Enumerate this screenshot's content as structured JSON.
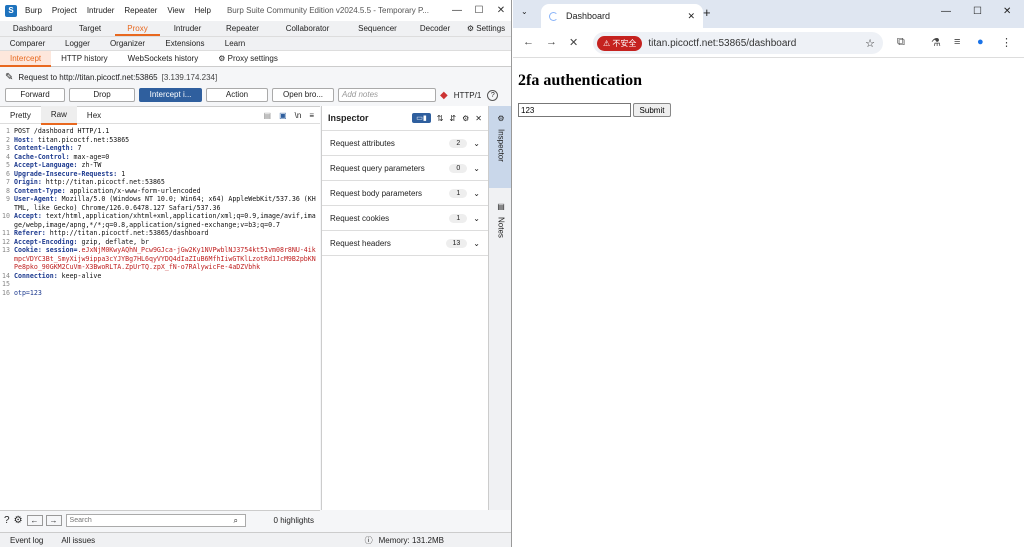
{
  "burp": {
    "title": "Burp Suite Community Edition v2024.5.5 - Temporary P...",
    "menu": [
      "Burp",
      "Project",
      "Intruder",
      "Repeater",
      "View",
      "Help"
    ],
    "tabs_row1": [
      "Dashboard",
      "Target",
      "Proxy",
      "Intruder",
      "Repeater",
      "Collaborator",
      "Sequencer",
      "Decoder",
      "Settings"
    ],
    "tabs_row2": [
      "Comparer",
      "Logger",
      "Organizer",
      "Extensions",
      "Learn"
    ],
    "sub_tabs": [
      "Intercept",
      "HTTP history",
      "WebSockets history",
      "Proxy settings"
    ],
    "request_to": "Request to http://titan.picoctf.net:53865",
    "request_ip": "[3.139.174.234]",
    "buttons": {
      "forward": "Forward",
      "drop": "Drop",
      "intercept": "Intercept i...",
      "action": "Action",
      "open_browser": "Open bro...",
      "notes_placeholder": "Add notes",
      "http_version": "HTTP/1"
    },
    "editor_tabs": [
      "Pretty",
      "Raw",
      "Hex"
    ],
    "code_lines": [
      {
        "n": "1",
        "k": "",
        "v": "POST /dashboard HTTP/1.1"
      },
      {
        "n": "2",
        "k": "Host:",
        "v": " titan.picoctf.net:53865"
      },
      {
        "n": "3",
        "k": "Content-Length:",
        "v": " 7"
      },
      {
        "n": "4",
        "k": "Cache-Control:",
        "v": " max-age=0"
      },
      {
        "n": "5",
        "k": "Accept-Language:",
        "v": " zh-TW"
      },
      {
        "n": "6",
        "k": "Upgrade-Insecure-Requests:",
        "v": " 1"
      },
      {
        "n": "7",
        "k": "Origin:",
        "v": " http://titan.picoctf.net:53865"
      },
      {
        "n": "8",
        "k": "Content-Type:",
        "v": " application/x-www-form-urlencoded"
      },
      {
        "n": "9",
        "k": "User-Agent:",
        "v": " Mozilla/5.0 (Windows NT 10.0; Win64; x64) AppleWebKit/537.36 (KHTML, like Gecko) Chrome/126.0.6478.127 Safari/537.36"
      },
      {
        "n": "10",
        "k": "Accept:",
        "v": " text/html,application/xhtml+xml,application/xml;q=0.9,image/avif,image/webp,image/apng,*/*;q=0.8,application/signed-exchange;v=b3;q=0.7"
      },
      {
        "n": "11",
        "k": "Referer:",
        "v": " http://titan.picoctf.net:53865/dashboard"
      },
      {
        "n": "12",
        "k": "Accept-Encoding:",
        "v": " gzip, deflate, br"
      },
      {
        "n": "13",
        "k": "Cookie:",
        "v": " session=",
        "cookie": ".eJxNjM0KwyAQhN_Pcw9GJca-jGw2Ky1NVPwblNJ3754kt51vm08r8NU-4ikmpcVDYC3Bt_SmyXijw9ippa3cYJYBg7HL6qyVYDQ4dIaZIuB6MfhIiwGTKlLzotRd1JcM9B2pbKNPe8pko_90GKM2CuVm-X3BwoRLTA.ZpUrTQ.zpX_fN-o7RAlywicFe-4aDZVbhk"
      },
      {
        "n": "14",
        "k": "Connection:",
        "v": " keep-alive"
      },
      {
        "n": "15",
        "k": "",
        "v": ""
      },
      {
        "n": "16",
        "k": "",
        "v": "otp=123"
      }
    ],
    "inspector": {
      "title": "Inspector",
      "rows": [
        {
          "label": "Request attributes",
          "count": "2"
        },
        {
          "label": "Request query parameters",
          "count": "0"
        },
        {
          "label": "Request body parameters",
          "count": "1"
        },
        {
          "label": "Request cookies",
          "count": "1"
        },
        {
          "label": "Request headers",
          "count": "13"
        }
      ]
    },
    "side_tabs": [
      "Inspector",
      "Notes"
    ],
    "search_placeholder": "Search",
    "highlights": "0 highlights",
    "status": {
      "event_log": "Event log",
      "all_issues": "All issues",
      "memory": "Memory: 131.2MB"
    }
  },
  "chrome": {
    "tab_title": "Dashboard",
    "warning": "不安全",
    "url": "titan.picoctf.net:53865/dashboard",
    "page_heading": "2fa authentication",
    "otp_value": "123",
    "submit_label": "Submit"
  },
  "colors": {
    "accent": "#e8681f",
    "primary_btn": "#2f5f9e",
    "warn": "#c5221f"
  }
}
